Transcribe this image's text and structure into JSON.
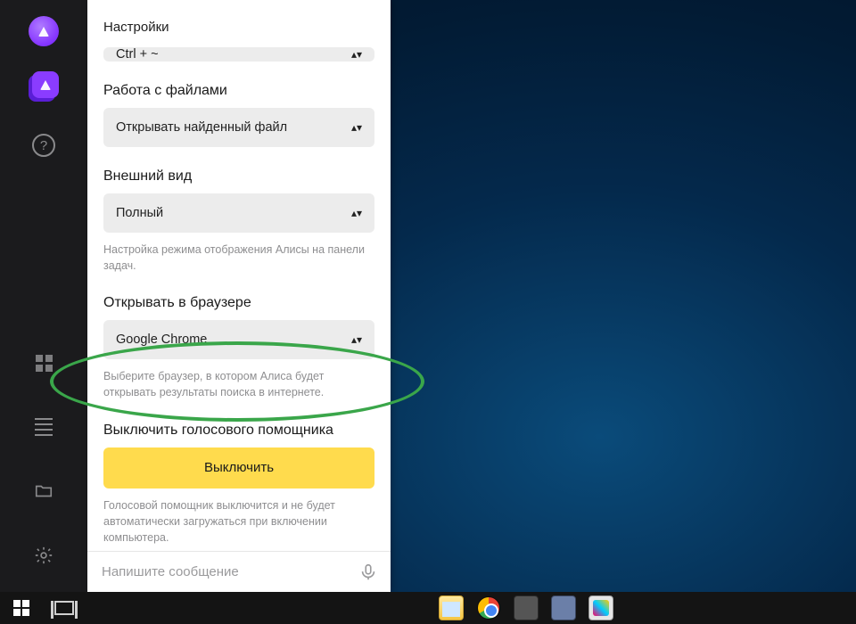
{
  "rail": {
    "alice_icon": "alice",
    "stack_icon": "alice-stack",
    "help_glyph": "?",
    "apps_icon": "apps-grid",
    "list_icon": "list-lines",
    "folder_icon": "folder",
    "settings_icon": "gear"
  },
  "panel": {
    "title": "Настройки",
    "hotkey": {
      "value": "Ctrl + ~"
    },
    "files": {
      "title": "Работа с файлами",
      "value": "Открывать найденный файл"
    },
    "appearance": {
      "title": "Внешний вид",
      "value": "Полный",
      "help": "Настройка режима отображения Алисы на панели задач."
    },
    "browser": {
      "title": "Открывать в браузере",
      "value": "Google Chrome",
      "help": "Выберите браузер, в котором Алиса будет открывать результаты поиска в интернете."
    },
    "disable": {
      "title": "Выключить голосового помощника",
      "button": "Выключить",
      "help": "Голосовой помощник выключится и не будет автоматически загружаться при включении компьютера."
    }
  },
  "input": {
    "placeholder": "Напишите сообщение"
  },
  "taskbar": {
    "start": "start",
    "taskview": "task-view",
    "items": [
      "file-explorer",
      "google-chrome",
      "app-3",
      "app-4",
      "paint"
    ]
  }
}
